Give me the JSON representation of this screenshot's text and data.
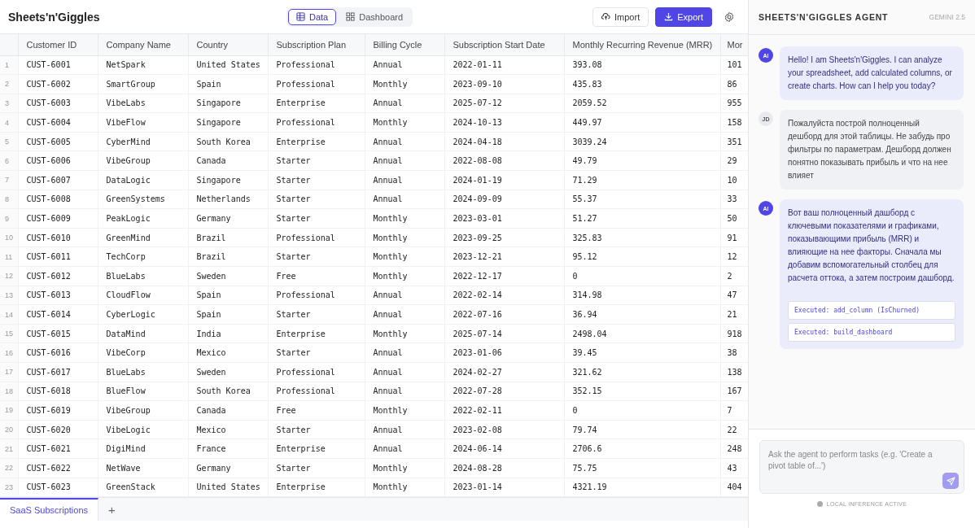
{
  "app_title": "Sheets'n'Giggles",
  "view_tabs": [
    {
      "label": "Data",
      "selected": true
    },
    {
      "label": "Dashboard",
      "selected": false
    }
  ],
  "actions": [
    {
      "label": "Import",
      "kind": "secondary"
    },
    {
      "label": "Export",
      "kind": "primary"
    }
  ],
  "table": {
    "columns": [
      "Customer ID",
      "Company Name",
      "Country",
      "Subscription Plan",
      "Billing Cycle",
      "Subscription Start Date",
      "Monthly Recurring Revenue (MRR)",
      "Mor"
    ],
    "rows": [
      {
        "number": "1",
        "cells": [
          "CUST-6001",
          "NetSpark",
          "United States",
          "Professional",
          "Annual",
          "2022-01-11",
          "393.08",
          "101"
        ]
      },
      {
        "number": "2",
        "cells": [
          "CUST-6002",
          "SmartGroup",
          "Spain",
          "Professional",
          "Monthly",
          "2023-09-10",
          "435.83",
          "86"
        ]
      },
      {
        "number": "3",
        "cells": [
          "CUST-6003",
          "VibeLabs",
          "Singapore",
          "Enterprise",
          "Annual",
          "2025-07-12",
          "2059.52",
          "955"
        ]
      },
      {
        "number": "4",
        "cells": [
          "CUST-6004",
          "VibeFlow",
          "Singapore",
          "Professional",
          "Monthly",
          "2024-10-13",
          "449.97",
          "158"
        ]
      },
      {
        "number": "5",
        "cells": [
          "CUST-6005",
          "CyberMind",
          "South Korea",
          "Enterprise",
          "Annual",
          "2024-04-18",
          "3039.24",
          "351"
        ]
      },
      {
        "number": "6",
        "cells": [
          "CUST-6006",
          "VibeGroup",
          "Canada",
          "Starter",
          "Annual",
          "2022-08-08",
          "49.79",
          "29"
        ]
      },
      {
        "number": "7",
        "cells": [
          "CUST-6007",
          "DataLogic",
          "Singapore",
          "Starter",
          "Annual",
          "2024-01-19",
          "71.29",
          "10"
        ]
      },
      {
        "number": "8",
        "cells": [
          "CUST-6008",
          "GreenSystems",
          "Netherlands",
          "Starter",
          "Annual",
          "2024-09-09",
          "55.37",
          "33"
        ]
      },
      {
        "number": "9",
        "cells": [
          "CUST-6009",
          "PeakLogic",
          "Germany",
          "Starter",
          "Monthly",
          "2023-03-01",
          "51.27",
          "50"
        ]
      },
      {
        "number": "10",
        "cells": [
          "CUST-6010",
          "GreenMind",
          "Brazil",
          "Professional",
          "Monthly",
          "2023-09-25",
          "325.83",
          "91"
        ]
      },
      {
        "number": "11",
        "cells": [
          "CUST-6011",
          "TechCorp",
          "Brazil",
          "Starter",
          "Monthly",
          "2023-12-21",
          "95.12",
          "12"
        ]
      },
      {
        "number": "12",
        "cells": [
          "CUST-6012",
          "BlueLabs",
          "Sweden",
          "Free",
          "Monthly",
          "2022-12-17",
          "0",
          "2"
        ]
      },
      {
        "number": "13",
        "cells": [
          "CUST-6013",
          "CloudFlow",
          "Spain",
          "Professional",
          "Annual",
          "2022-02-14",
          "314.98",
          "47"
        ]
      },
      {
        "number": "14",
        "cells": [
          "CUST-6014",
          "CyberLogic",
          "Spain",
          "Starter",
          "Annual",
          "2022-07-16",
          "36.94",
          "21"
        ]
      },
      {
        "number": "15",
        "cells": [
          "CUST-6015",
          "DataMind",
          "India",
          "Enterprise",
          "Monthly",
          "2025-07-14",
          "2498.04",
          "918"
        ]
      },
      {
        "number": "16",
        "cells": [
          "CUST-6016",
          "VibeCorp",
          "Mexico",
          "Starter",
          "Annual",
          "2023-01-06",
          "39.45",
          "38"
        ]
      },
      {
        "number": "17",
        "cells": [
          "CUST-6017",
          "BlueLabs",
          "Sweden",
          "Professional",
          "Annual",
          "2024-02-27",
          "321.62",
          "138"
        ]
      },
      {
        "number": "18",
        "cells": [
          "CUST-6018",
          "BlueFlow",
          "South Korea",
          "Professional",
          "Annual",
          "2022-07-28",
          "352.15",
          "167"
        ]
      },
      {
        "number": "19",
        "cells": [
          "CUST-6019",
          "VibeGroup",
          "Canada",
          "Free",
          "Monthly",
          "2022-02-11",
          "0",
          "7"
        ]
      },
      {
        "number": "20",
        "cells": [
          "CUST-6020",
          "VibeLogic",
          "Mexico",
          "Starter",
          "Annual",
          "2023-02-08",
          "79.74",
          "22"
        ]
      },
      {
        "number": "21",
        "cells": [
          "CUST-6021",
          "DigiMind",
          "France",
          "Enterprise",
          "Annual",
          "2024-06-14",
          "2706.6",
          "248"
        ]
      },
      {
        "number": "22",
        "cells": [
          "CUST-6022",
          "NetWave",
          "Germany",
          "Starter",
          "Monthly",
          "2024-08-28",
          "75.75",
          "43"
        ]
      },
      {
        "number": "23",
        "cells": [
          "CUST-6023",
          "GreenStack",
          "United States",
          "Enterprise",
          "Monthly",
          "2023-01-14",
          "4321.19",
          "404"
        ]
      }
    ]
  },
  "sheet_tabs": [
    {
      "label": "SaaS Subscriptions",
      "selected": true
    }
  ],
  "add_sheet": "+",
  "agent": {
    "title": "SHEETS'N'GIGGLES AGENT",
    "model": "GEMINI 2.5",
    "messages": [
      {
        "kind": "agent",
        "avatar": "AI",
        "text": "Hello! I am Sheets'n'Giggles. I can analyze your spreadsheet, add calculated columns, or create charts. How can I help you today?"
      },
      {
        "kind": "user",
        "avatar": "JD",
        "text": "Пожалуйста построй полноценный дешборд для этой таблицы. Не забудь про фильтры по параметрам. Дешборд должен понятно показывать прибыль и что на нее влияет"
      },
      {
        "kind": "agent",
        "avatar": "AI",
        "text": "Вот ваш полноценный дашборд с ключевыми показателями и графиками, показывающими прибыль (MRR) и влияющие на нее факторы. Сначала мы добавим вспомогательный столбец для расчета оттока, а затем построим дашборд.",
        "tools": [
          "Executed: add_column (IsChurned)",
          "Executed: build_dashboard"
        ]
      }
    ],
    "input": {
      "placeholder": "Ask the agent to perform tasks (e.g. 'Create a pivot table of...')"
    },
    "status": "LOCAL INFERENCE ACTIVE"
  }
}
